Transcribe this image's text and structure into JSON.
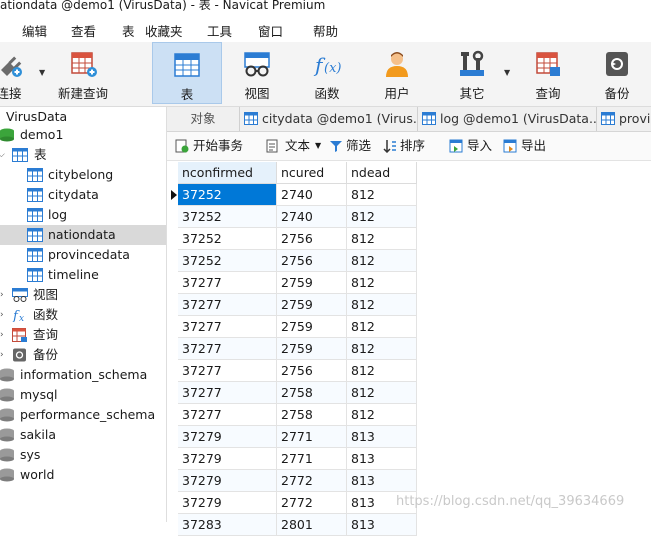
{
  "window": {
    "title": "ationdata @demo1 (VirusData) - 表 - Navicat Premium"
  },
  "menu": [
    "编辑",
    "查看",
    "表",
    "收藏夹",
    "工具",
    "窗口",
    "帮助"
  ],
  "toolbar": {
    "buttons": [
      {
        "label": "连接",
        "icon": "plug-icon"
      },
      {
        "label": "新建查询",
        "icon": "new-query-icon"
      },
      {
        "label": "表",
        "icon": "table-icon",
        "active": true
      },
      {
        "label": "视图",
        "icon": "view-icon"
      },
      {
        "label": "函数",
        "icon": "function-icon"
      },
      {
        "label": "用户",
        "icon": "user-icon"
      },
      {
        "label": "其它",
        "icon": "tools-icon"
      },
      {
        "label": "查询",
        "icon": "query-icon"
      },
      {
        "label": "备份",
        "icon": "backup-icon"
      }
    ]
  },
  "navigator": {
    "connection": "VirusData",
    "items": [
      {
        "label": "demo1",
        "kind": "database"
      },
      {
        "label": "表",
        "kind": "group"
      },
      {
        "label": "citybelong",
        "kind": "table"
      },
      {
        "label": "citydata",
        "kind": "table"
      },
      {
        "label": "log",
        "kind": "table"
      },
      {
        "label": "nationdata",
        "kind": "table",
        "selected": true
      },
      {
        "label": "provincedata",
        "kind": "table"
      },
      {
        "label": "timeline",
        "kind": "table"
      },
      {
        "label": "视图",
        "kind": "group"
      },
      {
        "label": "函数",
        "kind": "group"
      },
      {
        "label": "查询",
        "kind": "group"
      },
      {
        "label": "备份",
        "kind": "group"
      },
      {
        "label": "information_schema",
        "kind": "database"
      },
      {
        "label": "mysql",
        "kind": "database"
      },
      {
        "label": "performance_schema",
        "kind": "database"
      },
      {
        "label": "sakila",
        "kind": "database"
      },
      {
        "label": "sys",
        "kind": "database"
      },
      {
        "label": "world",
        "kind": "database"
      }
    ]
  },
  "tabs": [
    "对象",
    "citydata @demo1 (Virus...",
    "log @demo1 (VirusData...",
    "provi"
  ],
  "subtoolbar": {
    "start_transaction": "开始事务",
    "text": "文本",
    "filter": "筛选",
    "sort": "排序",
    "import": "导入",
    "export": "导出"
  },
  "grid": {
    "columns": [
      "nconfirmed",
      "ncured",
      "ndead"
    ],
    "rows": [
      [
        "37252",
        "2740",
        "812"
      ],
      [
        "37252",
        "2740",
        "812"
      ],
      [
        "37252",
        "2756",
        "812"
      ],
      [
        "37252",
        "2756",
        "812"
      ],
      [
        "37277",
        "2759",
        "812"
      ],
      [
        "37277",
        "2759",
        "812"
      ],
      [
        "37277",
        "2759",
        "812"
      ],
      [
        "37277",
        "2759",
        "812"
      ],
      [
        "37277",
        "2756",
        "812"
      ],
      [
        "37277",
        "2758",
        "812"
      ],
      [
        "37277",
        "2758",
        "812"
      ],
      [
        "37279",
        "2771",
        "813"
      ],
      [
        "37279",
        "2771",
        "813"
      ],
      [
        "37279",
        "2772",
        "813"
      ],
      [
        "37279",
        "2772",
        "813"
      ],
      [
        "37283",
        "2801",
        "813"
      ]
    ]
  },
  "watermark": "https://blog.csdn.net/qq_39634669"
}
